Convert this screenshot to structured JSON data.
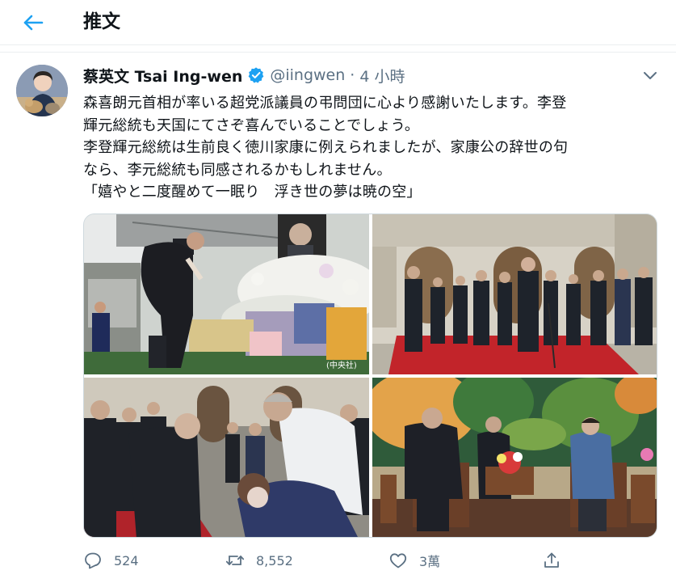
{
  "header": {
    "title": "推文"
  },
  "author": {
    "name": "蔡英文 Tsai Ing-wen",
    "handle": "@iingwen",
    "separator": "·",
    "time": "4 小時"
  },
  "tweet": {
    "lines": [
      "森喜朗元首相が率いる超党派議員の弔問団に心より感謝いたします。李登",
      "輝元総統も天国にてさぞ喜んでいることでしょう。",
      "李登輝元総統は生前良く徳川家康に例えられましたが、家康公の辞世の句",
      "なら、李元総統も同感されるかもしれません。",
      "「嬉やと二度醒めて一眠り　浮き世の夢は暁の空」"
    ]
  },
  "media": {
    "photo1_watermark": "(中央社)"
  },
  "actions": {
    "reply_count": "524",
    "retweet_count": "8,552",
    "like_count": "3萬"
  },
  "colors": {
    "accent": "#1da1f2",
    "muted": "#5b7083"
  }
}
